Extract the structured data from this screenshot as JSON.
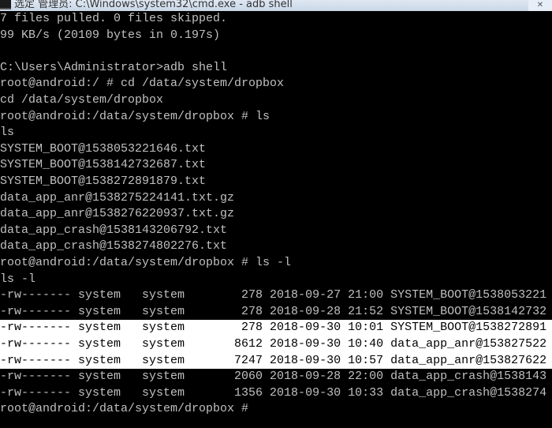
{
  "window": {
    "title": "选定 管理员: C:\\Windows\\system32\\cmd.exe - adb shell"
  },
  "terminal": {
    "lines": [
      "7 files pulled. 0 files skipped.",
      "99 KB/s (20109 bytes in 0.197s)",
      "",
      "C:\\Users\\Administrator>adb shell",
      "root@android:/ # cd /data/system/dropbox",
      "cd /data/system/dropbox",
      "root@android:/data/system/dropbox # ls",
      "ls",
      "SYSTEM_BOOT@1538053221646.txt",
      "SYSTEM_BOOT@1538142732687.txt",
      "SYSTEM_BOOT@1538272891879.txt",
      "data_app_anr@1538275224141.txt.gz",
      "data_app_anr@1538276220937.txt.gz",
      "data_app_crash@1538143206792.txt",
      "data_app_crash@1538274802276.txt",
      "root@android:/data/system/dropbox # ls -l",
      "ls -l",
      "-rw------- system   system        278 2018-09-27 21:00 SYSTEM_BOOT@1538053221",
      "-rw------- system   system        278 2018-09-28 21:52 SYSTEM_BOOT@1538142732",
      "-rw------- system   system        278 2018-09-30 10:01 SYSTEM_BOOT@1538272891",
      "-rw------- system   system       8612 2018-09-30 10:40 data_app_anr@153827522",
      "-rw------- system   system       7247 2018-09-30 10:57 data_app_anr@153827622",
      "-rw------- system   system       2060 2018-09-28 22:00 data_app_crash@1538143",
      "-rw------- system   system       1356 2018-09-30 10:33 data_app_crash@1538274",
      "root@android:/data/system/dropbox # "
    ],
    "selected_rows": [
      19,
      20,
      21
    ],
    "colors": {
      "background": "#000000",
      "text": "#c0c0c0",
      "selection_bg": "#ffffff",
      "selection_text": "#000000"
    }
  }
}
